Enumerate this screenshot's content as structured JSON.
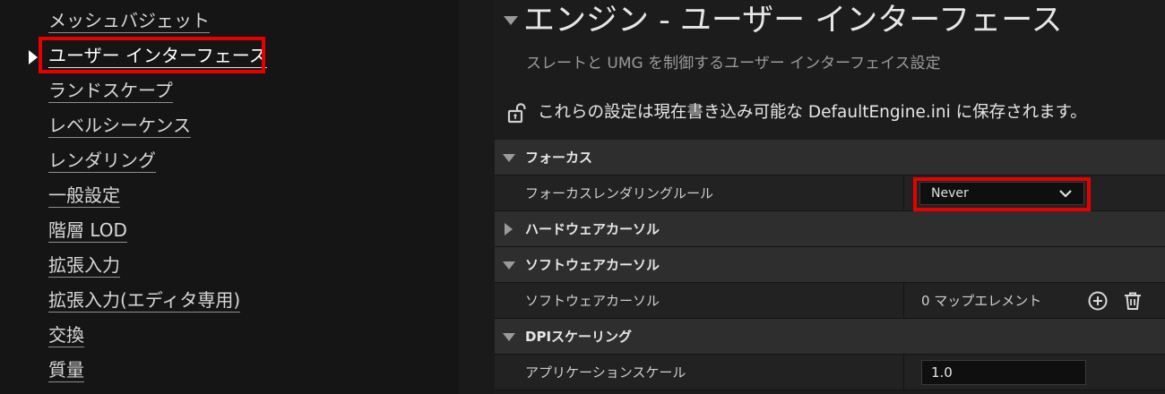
{
  "sidebar": {
    "items": [
      {
        "label": "メッシュバジェット"
      },
      {
        "label": "ユーザー インターフェース"
      },
      {
        "label": "ランドスケープ"
      },
      {
        "label": "レベルシーケンス"
      },
      {
        "label": "レンダリング"
      },
      {
        "label": "一般設定"
      },
      {
        "label": "階層 LOD"
      },
      {
        "label": "拡張入力"
      },
      {
        "label": "拡張入力(エディタ専用)"
      },
      {
        "label": "交換"
      },
      {
        "label": "質量"
      }
    ],
    "selected_label": "ユーザー インターフェース"
  },
  "main": {
    "title": "エンジン - ユーザー インターフェース",
    "subtitle": "スレートと UMG を制御するユーザー インターフェイス設定",
    "save_note": "これらの設定は現在書き込み可能な DefaultEngine.ini に保存されます。",
    "sections": {
      "focus": {
        "label": "フォーカス",
        "expanded": true,
        "render_rule_label": "フォーカスレンダリングルール",
        "render_rule_value": "Never"
      },
      "hardware_cursor": {
        "label": "ハードウェアカーソル",
        "expanded": false
      },
      "software_cursor": {
        "label": "ソフトウェアカーソル",
        "expanded": true,
        "prop_label": "ソフトウェアカーソル",
        "prop_value": "0 マップエレメント"
      },
      "dpi": {
        "label": "DPIスケーリング",
        "expanded": true,
        "app_scale_label": "アプリケーションスケール",
        "app_scale_value": "1.0"
      }
    }
  },
  "colors": {
    "highlight": "#e80000",
    "background": "#151515",
    "panel": "#1c1c1c",
    "category_row": "#2e2e2e",
    "property_row": "#222222"
  },
  "icons": {
    "lock": "unlocked-lock-icon",
    "add": "add-circle-icon",
    "delete": "trash-icon",
    "chevron": "chevron-down-icon"
  }
}
